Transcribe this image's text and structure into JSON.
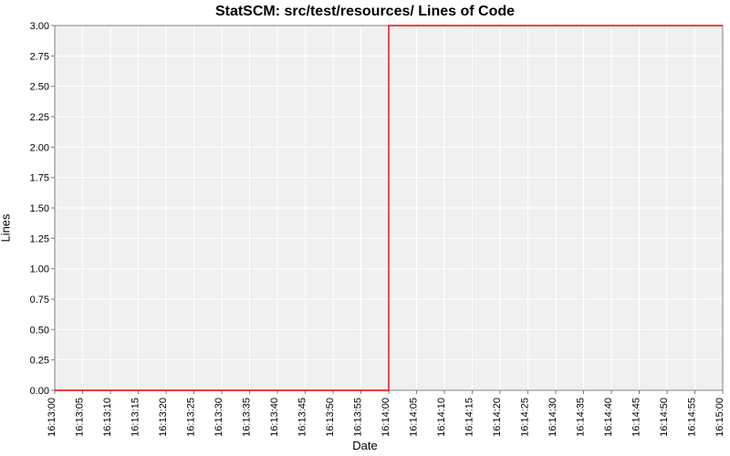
{
  "chart_data": {
    "type": "line",
    "title": "StatSCM: src/test/resources/ Lines of Code",
    "xlabel": "Date",
    "ylabel": "Lines",
    "ylim": [
      0,
      3
    ],
    "xlim": [
      "16:13:00",
      "16:15:00"
    ],
    "x_ticks": [
      "16:13:00",
      "16:13:05",
      "16:13:10",
      "16:13:15",
      "16:13:20",
      "16:13:25",
      "16:13:30",
      "16:13:35",
      "16:13:40",
      "16:13:45",
      "16:13:50",
      "16:13:55",
      "16:14:00",
      "16:14:05",
      "16:14:10",
      "16:14:15",
      "16:14:20",
      "16:14:25",
      "16:14:30",
      "16:14:35",
      "16:14:40",
      "16:14:45",
      "16:14:50",
      "16:14:55",
      "16:15:00"
    ],
    "y_ticks": [
      0.0,
      0.25,
      0.5,
      0.75,
      1.0,
      1.25,
      1.5,
      1.75,
      2.0,
      2.25,
      2.5,
      2.75,
      3.0
    ],
    "series": [
      {
        "name": "Lines",
        "color": "#ee0000",
        "x": [
          "16:13:00",
          "16:14:00",
          "16:14:00",
          "16:15:00"
        ],
        "y": [
          0,
          0,
          3,
          3
        ]
      }
    ],
    "plot_bg": "#f0f0f0",
    "grid": true
  }
}
